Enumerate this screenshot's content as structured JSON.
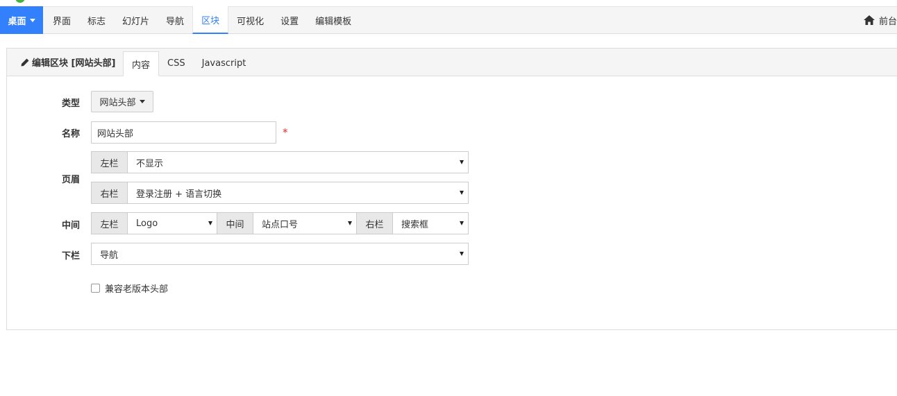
{
  "nav": {
    "home_label": "桌面",
    "items": [
      "界面",
      "标志",
      "幻灯片",
      "导航",
      "区块",
      "可视化",
      "设置",
      "编辑模板"
    ],
    "active_index": 4,
    "right_label": "前台"
  },
  "panel": {
    "title": "编辑区块 [网站头部]",
    "tabs": [
      "内容",
      "CSS",
      "Javascript"
    ]
  },
  "form": {
    "type_label": "类型",
    "type_value": "网站头部",
    "name_label": "名称",
    "name_value": "网站头部",
    "required_mark": "*",
    "header_label": "页眉",
    "header_left_addon": "左栏",
    "header_left_value": "不显示",
    "header_right_addon": "右栏",
    "header_right_value": "登录注册 + 语言切换",
    "middle_label": "中间",
    "middle_left_addon": "左栏",
    "middle_left_value": "Logo",
    "middle_center_addon": "中间",
    "middle_center_value": "站点口号",
    "middle_right_addon": "右栏",
    "middle_right_value": "搜索框",
    "bottom_label": "下栏",
    "bottom_value": "导航",
    "compat_label": "兼容老版本头部"
  },
  "colors": {
    "accent": "#3280fc",
    "required": "#e03030"
  },
  "icons": {
    "home": "home-icon",
    "edit": "pencil-icon"
  }
}
